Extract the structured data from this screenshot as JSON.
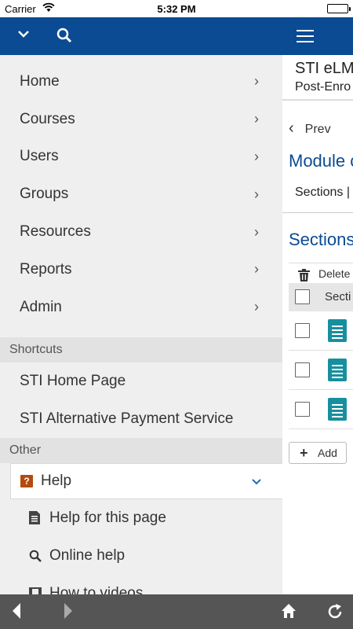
{
  "status_bar": {
    "carrier": "Carrier",
    "time": "5:32 PM"
  },
  "drawer": {
    "nav": [
      {
        "label": "Home"
      },
      {
        "label": "Courses"
      },
      {
        "label": "Users"
      },
      {
        "label": "Groups"
      },
      {
        "label": "Resources"
      },
      {
        "label": "Reports"
      },
      {
        "label": "Admin"
      }
    ],
    "shortcuts_heading": "Shortcuts",
    "shortcuts": [
      {
        "label": "STI Home Page"
      },
      {
        "label": "STI Alternative Payment Service"
      }
    ],
    "other_heading": "Other",
    "help": {
      "label": "Help",
      "items": [
        {
          "label": "Help for this page",
          "icon": "document-icon"
        },
        {
          "label": "Online help",
          "icon": "search-icon"
        },
        {
          "label": "How to videos",
          "icon": "film-icon"
        }
      ]
    }
  },
  "content": {
    "site_title": "STI eLM",
    "site_subtitle": "Post-Enro",
    "prev_label": "Prev",
    "module_title": "Module c",
    "tab_label": "Sections |",
    "sections_heading": "Sections",
    "delete_label": "Delete",
    "column_header": "Secti",
    "row_count": 3,
    "add_label": "Add"
  },
  "colors": {
    "brand": "#0a4b93",
    "doc_icon": "#178f9e",
    "help_icon": "#b34a0f",
    "toolbar": "#555555"
  }
}
